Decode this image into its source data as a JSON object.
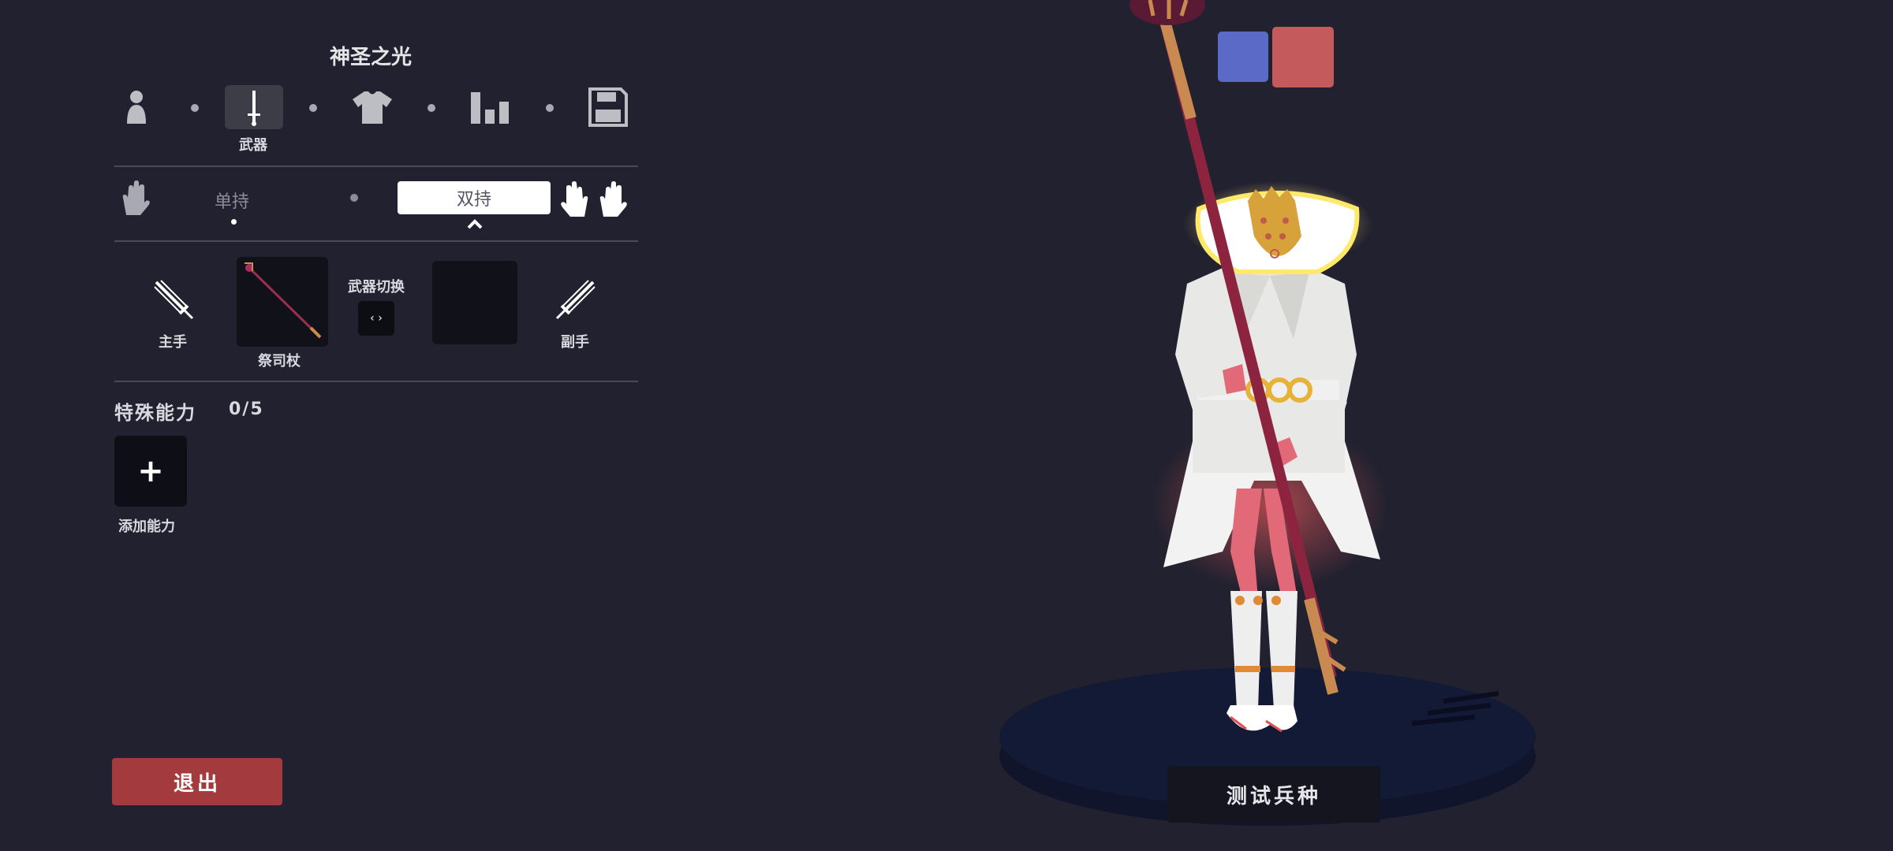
{
  "header": {
    "title": "神圣之光"
  },
  "tabs": [
    {
      "icon": "person-icon",
      "label": ""
    },
    {
      "icon": "sword-icon",
      "label": "武器"
    },
    {
      "icon": "shirt-icon",
      "label": ""
    },
    {
      "icon": "stats-icon",
      "label": ""
    },
    {
      "icon": "save-icon",
      "label": ""
    }
  ],
  "grip": {
    "single_label": "单持",
    "dual_label": "双持",
    "selected": "双持"
  },
  "weapons": {
    "main_hand_label": "主手",
    "main_weapon_name": "祭司杖",
    "switch_label": "武器切换",
    "switch_symbol": "‹ ›",
    "off_hand_label": "副手"
  },
  "abilities": {
    "title": "特殊能力",
    "count": "0/5",
    "add_symbol": "+",
    "add_label": "添加能力"
  },
  "colors": {
    "primary": "#5a6ac6",
    "secondary": "#c45a5c",
    "exit_button": "#a23a3e",
    "background": "#22212f",
    "pedestal": "#131a35"
  },
  "buttons": {
    "exit_label": "退出",
    "test_label": "测试兵种"
  }
}
